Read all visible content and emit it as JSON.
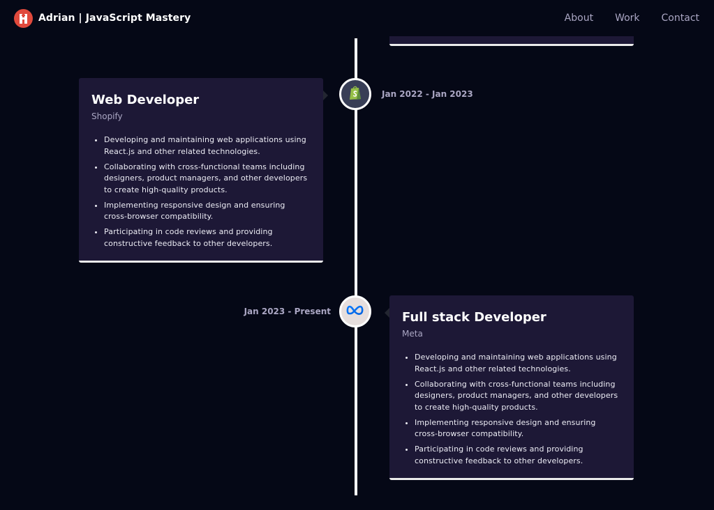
{
  "navbar": {
    "brand": "Adrian  | JavaScript Mastery",
    "links": [
      "About",
      "Work",
      "Contact"
    ]
  },
  "experiences": [
    {
      "title": "Web Developer",
      "company": "Shopify",
      "date": "Jan 2022 - Jan 2023",
      "icon": "shopify-icon",
      "icon_bg": "#383E56",
      "points": [
        "Developing and maintaining web applications using React.js and other related technologies.",
        "Collaborating with cross-functional teams including designers, product managers, and other developers to create high-quality products.",
        "Implementing responsive design and ensuring cross-browser compatibility.",
        "Participating in code reviews and providing constructive feedback to other developers."
      ]
    },
    {
      "title": "Full stack Developer",
      "company": "Meta",
      "date": "Jan 2023 - Present",
      "icon": "meta-icon",
      "icon_bg": "#E6DEDD",
      "points": [
        "Developing and maintaining web applications using React.js and other related technologies.",
        "Collaborating with cross-functional teams including designers, product managers, and other developers to create high-quality products.",
        "Implementing responsive design and ensuring cross-browser compatibility.",
        "Participating in code reviews and providing constructive feedback to other developers."
      ]
    }
  ],
  "colors": {
    "background": "#050816",
    "card": "#1D1836",
    "secondary_text": "#AAA6C3",
    "logo": "#E0493C"
  }
}
